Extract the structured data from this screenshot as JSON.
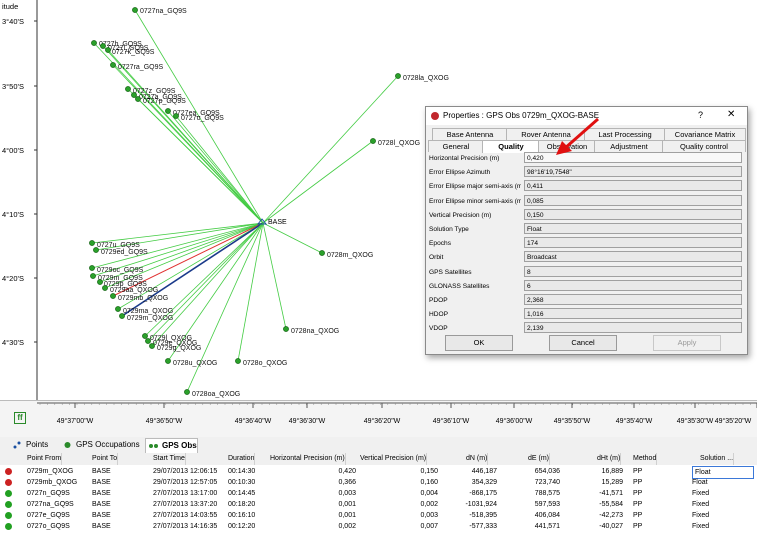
{
  "plot": {
    "axis_top_label": "itude",
    "lat_labels": [
      "3°40'S",
      "3°50'S",
      "4°00'S",
      "4°10'S",
      "4°20'S",
      "4°30'S"
    ],
    "lon_labels": [
      "49°37'00\"W",
      "49°36'50\"W",
      "49°36'40\"W",
      "49°36'30\"W",
      "49°36'20\"W",
      "49°36'10\"W",
      "49°36'00\"W",
      "49°35'50\"W",
      "49°35'40\"W",
      "49°35'30\"W",
      "49°35'20\"W"
    ],
    "corner_icon": "grid-icon",
    "base_label": "BASE",
    "points": [
      {
        "name": "0727na_GQ9S"
      },
      {
        "name": "0727h_GQ9S"
      },
      {
        "name": "0727i_GQ9S"
      },
      {
        "name": "0727k_GQ9S"
      },
      {
        "name": "0727ra_GQ9S"
      },
      {
        "name": "0727z_GQ9S"
      },
      {
        "name": "0727a_GQ9S"
      },
      {
        "name": "0727p_GQ9S"
      },
      {
        "name": "0727ea_GQ9S"
      },
      {
        "name": "0727o_GQ9S"
      },
      {
        "name": "0728la_QXOG"
      },
      {
        "name": "0728l_QXOG"
      },
      {
        "name": "0727u_GQ9S"
      },
      {
        "name": "0729ed_GQ9S"
      },
      {
        "name": "0728m_QXOG"
      },
      {
        "name": "0729oc_GQ9S"
      },
      {
        "name": "0729m_GQ9S"
      },
      {
        "name": "0729p_GQ9S"
      },
      {
        "name": "0729aa_QXOG"
      },
      {
        "name": "0729mb_QXOG"
      },
      {
        "name": "0729ma_QXOG"
      },
      {
        "name": "0729m_QXOG"
      },
      {
        "name": "0728na_QXOG"
      },
      {
        "name": "0729l_QXOG"
      },
      {
        "name": "0729e_QXOG"
      },
      {
        "name": "0729g_QXOG"
      },
      {
        "name": "0728u_QXOG"
      },
      {
        "name": "0728o_QXOG"
      },
      {
        "name": "0728oa_QXOG"
      }
    ]
  },
  "dialog": {
    "title": "Properties : GPS Obs 0729m_QXOG-BASE",
    "help": "?",
    "close": "✕",
    "tabs_row1": [
      "Base Antenna",
      "Rover Antenna",
      "Last Processing",
      "Covariance Matrix"
    ],
    "tabs_row2": [
      "General",
      "Quality",
      "Observation",
      "Adjustment",
      "Quality control"
    ],
    "active_tab": "Quality",
    "fields": [
      {
        "label": "Horizontal Precision (m)",
        "value": "0,420"
      },
      {
        "label": "Error Ellipse Azimuth",
        "value": "98°16'19,7548\""
      },
      {
        "label": "Error Ellipse major semi-axis (m)",
        "value": "0,411"
      },
      {
        "label": "Error Ellipse minor semi-axis (m)",
        "value": "0,085"
      },
      {
        "label": "Vertical Precision (m)",
        "value": "0,150"
      },
      {
        "label": "Solution Type",
        "value": "Float"
      },
      {
        "label": "Epochs",
        "value": "174"
      },
      {
        "label": "Orbit",
        "value": "Broadcast"
      },
      {
        "label": "GPS Satellites",
        "value": "8"
      },
      {
        "label": "GLONASS Satellites",
        "value": "6"
      },
      {
        "label": "PDOP",
        "value": "2,368"
      },
      {
        "label": "HDOP",
        "value": "1,016"
      },
      {
        "label": "VDOP",
        "value": "2,139"
      }
    ],
    "ok": "OK",
    "cancel": "Cancel",
    "apply": "Apply"
  },
  "panel": {
    "tabs": [
      {
        "label": "Points",
        "icon": "points-icon"
      },
      {
        "label": "GPS Occupations",
        "icon": "occupation-icon"
      },
      {
        "label": "GPS Obs",
        "icon": "gps-obs-icon"
      }
    ],
    "columns": [
      "Point From",
      "Point To",
      "Start Time",
      "Duration",
      "Horizontal Precision (m)",
      "Vertical Precision (m)",
      "dN (m)",
      "dE (m)",
      "dHt (m)",
      "Method",
      "Solution ..."
    ],
    "rows": [
      {
        "from": "0729m_QXOG",
        "to": "BASE",
        "start": "29/07/2013 12:06:15",
        "duration": "00:14:30",
        "hp": "0,420",
        "vp": "0,150",
        "dn": "446,187",
        "de": "654,036",
        "dht": "16,889",
        "method": "PP",
        "solution": "Float",
        "status_color": "#cc2222"
      },
      {
        "from": "0729mb_QXOG",
        "to": "BASE",
        "start": "29/07/2013 12:57:05",
        "duration": "00:10:30",
        "hp": "0,366",
        "vp": "0,160",
        "dn": "354,329",
        "de": "723,740",
        "dht": "15,289",
        "method": "PP",
        "solution": "Float",
        "status_color": "#cc2222"
      },
      {
        "from": "0727n_GQ9S",
        "to": "BASE",
        "start": "27/07/2013 13:17:00",
        "duration": "00:14:45",
        "hp": "0,003",
        "vp": "0,004",
        "dn": "-868,175",
        "de": "788,575",
        "dht": "-41,571",
        "method": "PP",
        "solution": "Fixed",
        "status_color": "#22a022"
      },
      {
        "from": "0727na_GQ9S",
        "to": "BASE",
        "start": "27/07/2013 13:37:20",
        "duration": "00:18:20",
        "hp": "0,001",
        "vp": "0,002",
        "dn": "-1031,924",
        "de": "597,593",
        "dht": "-55,584",
        "method": "PP",
        "solution": "Fixed",
        "status_color": "#22a022"
      },
      {
        "from": "0727e_GQ9S",
        "to": "BASE",
        "start": "27/07/2013 14:03:55",
        "duration": "00:16:10",
        "dn": "-518,395",
        "hp": "0,001",
        "vp": "0,003",
        "de": "406,084",
        "dht": "-42,273",
        "method": "PP",
        "solution": "Fixed",
        "status_color": "#22a022"
      },
      {
        "from": "0727o_GQ9S",
        "to": "BASE",
        "start": "27/07/2013 14:16:35",
        "duration": "00:12:20",
        "hp": "0,002",
        "vp": "0,007",
        "dn": "-577,333",
        "de": "441,571",
        "dht": "-40,027",
        "method": "PP",
        "solution": "Fixed",
        "status_color": "#22a022"
      }
    ]
  }
}
